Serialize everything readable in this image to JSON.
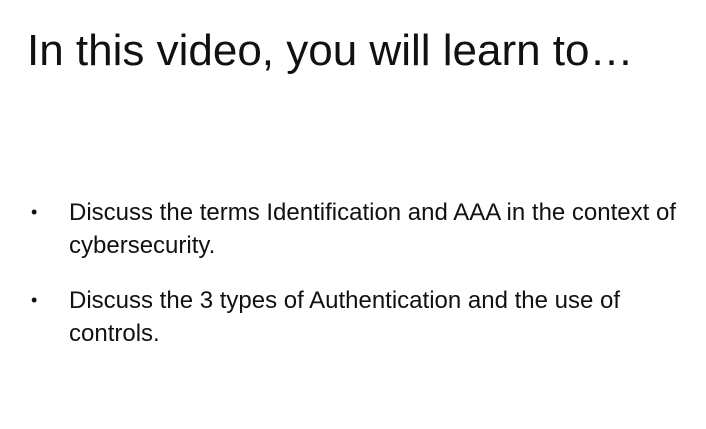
{
  "slide": {
    "title": "In this video, you will learn to…",
    "bullets": [
      {
        "marker": "•",
        "text": "Discuss the terms Identification and AAA in the context of cybersecurity."
      },
      {
        "marker": "•",
        "text": "Discuss the 3 types of Authentication and the use of controls."
      }
    ]
  }
}
